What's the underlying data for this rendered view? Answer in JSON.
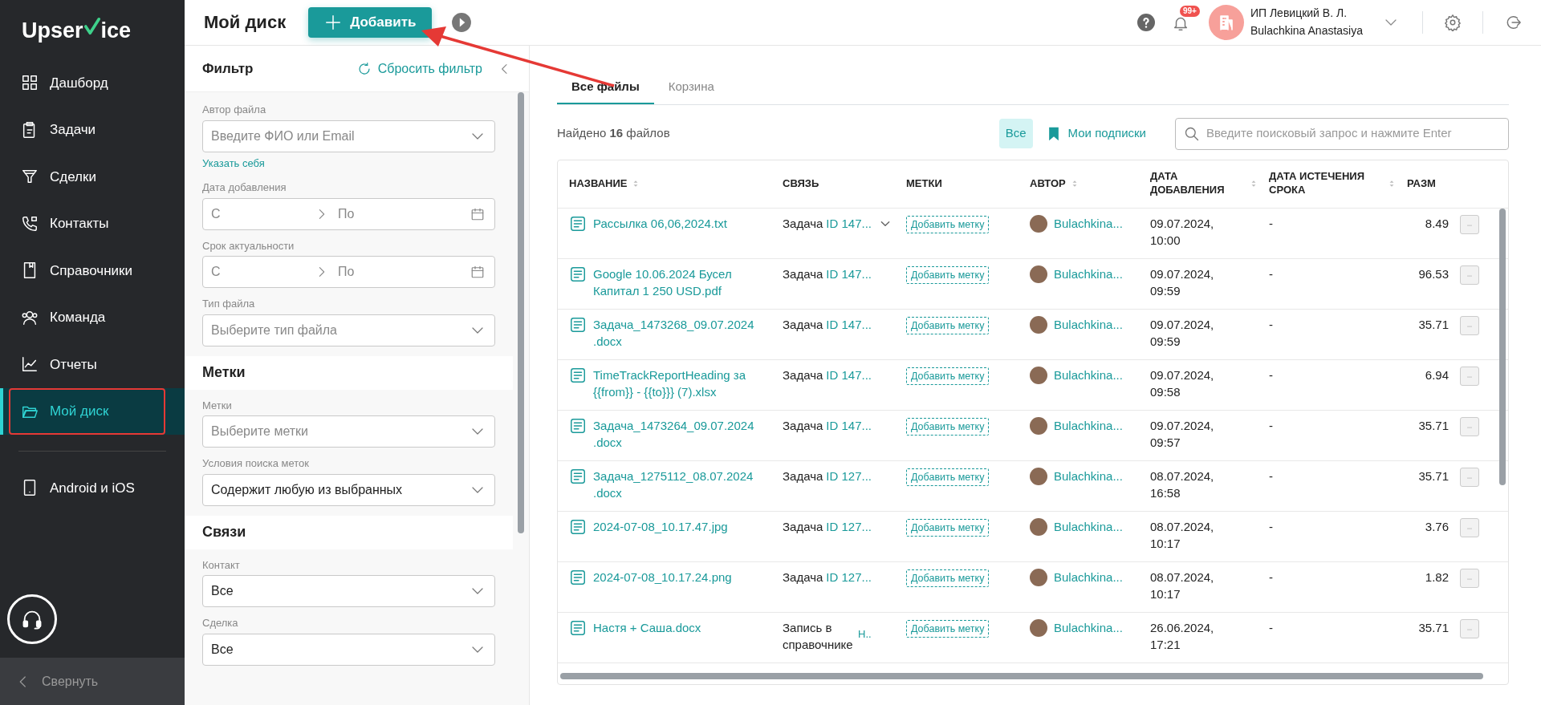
{
  "sidebar": {
    "logo_start": "Upser",
    "logo_end": "ice",
    "items": [
      {
        "label": "Дашборд",
        "selected": false,
        "highlighted": false
      },
      {
        "label": "Задачи",
        "selected": false,
        "highlighted": false
      },
      {
        "label": "Сделки",
        "selected": false,
        "highlighted": false
      },
      {
        "label": "Контакты",
        "selected": false,
        "highlighted": false
      },
      {
        "label": "Справочники",
        "selected": false,
        "highlighted": false
      },
      {
        "label": "Команда",
        "selected": false,
        "highlighted": false
      },
      {
        "label": "Отчеты",
        "selected": false,
        "highlighted": false
      },
      {
        "label": "Мой диск",
        "selected": true,
        "highlighted": true
      }
    ],
    "extra_items": [
      {
        "label": "Android и iOS"
      }
    ],
    "collapse_label": "Свернуть"
  },
  "header": {
    "title": "Мой диск",
    "add_button": "Добавить",
    "arrow_annotation": true,
    "notifications_badge": "99+",
    "account": {
      "company": "ИП Левицкий В. Л.",
      "user": "Bulachkina Anastasiya"
    }
  },
  "filter": {
    "title": "Фильтр",
    "reset": "Сбросить фильтр",
    "sections": [
      {
        "fields": [
          {
            "kind": "select",
            "label": "Автор файла",
            "placeholder": "Введите ФИО или Email",
            "link": "Указать себя"
          },
          {
            "kind": "daterange",
            "label": "Дата добавления",
            "from_placeholder": "С",
            "to_placeholder": "По"
          },
          {
            "kind": "daterange",
            "label": "Срок актуальности",
            "from_placeholder": "С",
            "to_placeholder": "По"
          },
          {
            "kind": "select",
            "label": "Тип файла",
            "placeholder": "Выберите тип файла"
          }
        ]
      },
      {
        "title": "Метки",
        "fields": [
          {
            "kind": "select",
            "label": "Метки",
            "placeholder": "Выберите метки"
          },
          {
            "kind": "select",
            "label": "Условия поиска меток",
            "value": "Содержит любую из выбранных"
          }
        ]
      },
      {
        "title": "Связи",
        "fields": [
          {
            "kind": "select",
            "label": "Контакт",
            "value": "Все"
          },
          {
            "kind": "select",
            "label": "Сделка",
            "value": "Все"
          }
        ]
      }
    ]
  },
  "tabs": [
    {
      "label": "Все файлы",
      "selected": true
    },
    {
      "label": "Корзина",
      "selected": false
    }
  ],
  "found_text": "Найдено **16** файлов",
  "scope_filters": [
    {
      "label": "Все",
      "selected": true,
      "kind": "plain"
    },
    {
      "label": "Мои подписки",
      "selected": false,
      "kind": "bookmark"
    }
  ],
  "search": {
    "placeholder": "Введите поисковый запрос и нажмите Enter"
  },
  "table": {
    "columns": [
      {
        "label": "НАЗВАНИЕ",
        "sortable": true
      },
      {
        "label": "СВЯЗЬ",
        "sortable": false
      },
      {
        "label": "МЕТКИ",
        "sortable": false
      },
      {
        "label": "АВТОР",
        "sortable": true
      },
      {
        "label": "ДАТА ДОБАВЛЕНИЯ",
        "sortable": true
      },
      {
        "label": "ДАТА ИСТЕЧЕНИЯ СРОКА",
        "sortable": true
      },
      {
        "label": "РАЗМ",
        "sortable": false
      }
    ],
    "rows": [
      {
        "name": "Рассылка 06,06,2024.txt",
        "link_type": "Задача",
        "link_id": "ID 147...",
        "link_expandable": true,
        "tag_button": "Добавить метку",
        "author": "Bulachkina...",
        "added": "09.07.2024, 10:00",
        "expires": "-",
        "size": "8.49"
      },
      {
        "name": "Google 10.06.2024 Бусел Капитал 1 250 USD.pdf",
        "link_type": "Задача",
        "link_id": "ID 147...",
        "link_expandable": false,
        "tag_button": "Добавить метку",
        "author": "Bulachkina...",
        "added": "09.07.2024, 09:59",
        "expires": "-",
        "size": "96.53"
      },
      {
        "name": "Задача_1473268_09.07.2024.docx",
        "link_type": "Задача",
        "link_id": "ID 147...",
        "link_expandable": false,
        "tag_button": "Добавить метку",
        "author": "Bulachkina...",
        "added": "09.07.2024, 09:59",
        "expires": "-",
        "size": "35.71"
      },
      {
        "name": "TimeTrackReportHeading за {{from}} - {{to}}} (7).xlsx",
        "link_type": "Задача",
        "link_id": "ID 147...",
        "link_expandable": false,
        "tag_button": "Добавить метку",
        "author": "Bulachkina...",
        "added": "09.07.2024, 09:58",
        "expires": "-",
        "size": "6.94"
      },
      {
        "name": "Задача_1473264_09.07.2024.docx",
        "link_type": "Задача",
        "link_id": "ID 147...",
        "link_expandable": false,
        "tag_button": "Добавить метку",
        "author": "Bulachkina...",
        "added": "09.07.2024, 09:57",
        "expires": "-",
        "size": "35.71"
      },
      {
        "name": "Задача_1275112_08.07.2024.docx",
        "link_type": "Задача",
        "link_id": "ID 127...",
        "link_expandable": false,
        "tag_button": "Добавить метку",
        "author": "Bulachkina...",
        "added": "08.07.2024, 16:58",
        "expires": "-",
        "size": "35.71"
      },
      {
        "name": "2024-07-08_10.17.47.jpg",
        "link_type": "Задача",
        "link_id": "ID 127...",
        "link_expandable": false,
        "tag_button": "Добавить метку",
        "author": "Bulachkina...",
        "added": "08.07.2024, 10:17",
        "expires": "-",
        "size": "3.76"
      },
      {
        "name": "2024-07-08_10.17.24.png",
        "link_type": "Задача",
        "link_id": "ID 127...",
        "link_expandable": false,
        "tag_button": "Добавить метку",
        "author": "Bulachkina...",
        "added": "08.07.2024, 10:17",
        "expires": "-",
        "size": "1.82"
      },
      {
        "name": "Настя + Саша.docx",
        "link_type": "Запись в справочнике",
        "link_id": "Н..",
        "link_expandable": false,
        "tag_button": "Добавить метку",
        "author": "Bulachkina...",
        "added": "26.06.2024, 17:21",
        "expires": "-",
        "size": "35.71"
      }
    ]
  }
}
